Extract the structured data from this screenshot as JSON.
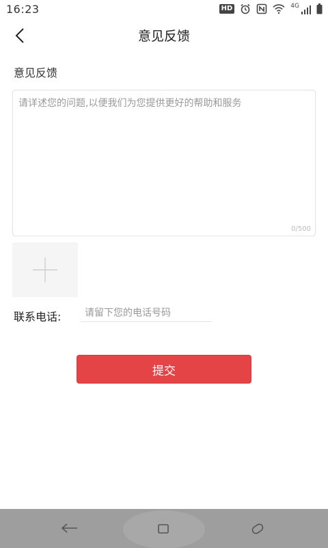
{
  "status_bar": {
    "time": "16:23",
    "hd_label": "HD",
    "network_label": "4G",
    "icons": [
      "hd-icon",
      "alarm-icon",
      "nfc-icon",
      "wifi-icon",
      "signal-icon",
      "battery-icon"
    ]
  },
  "header": {
    "title": "意见反馈",
    "back_icon": "chevron-left-icon"
  },
  "feedback": {
    "label": "意见反馈",
    "placeholder": "请详述您的问题,以便我们为您提供更好的帮助和服务",
    "value": "",
    "counter": "0/500"
  },
  "image_upload": {
    "icon": "plus-icon"
  },
  "contact": {
    "label": "联系电话:",
    "placeholder": "请留下您的电话号码",
    "value": ""
  },
  "submit": {
    "label": "提交",
    "color": "#e54446"
  },
  "nav_bar": {
    "icons": [
      "nav-back-icon",
      "nav-home-icon",
      "nav-recent-icon"
    ]
  }
}
